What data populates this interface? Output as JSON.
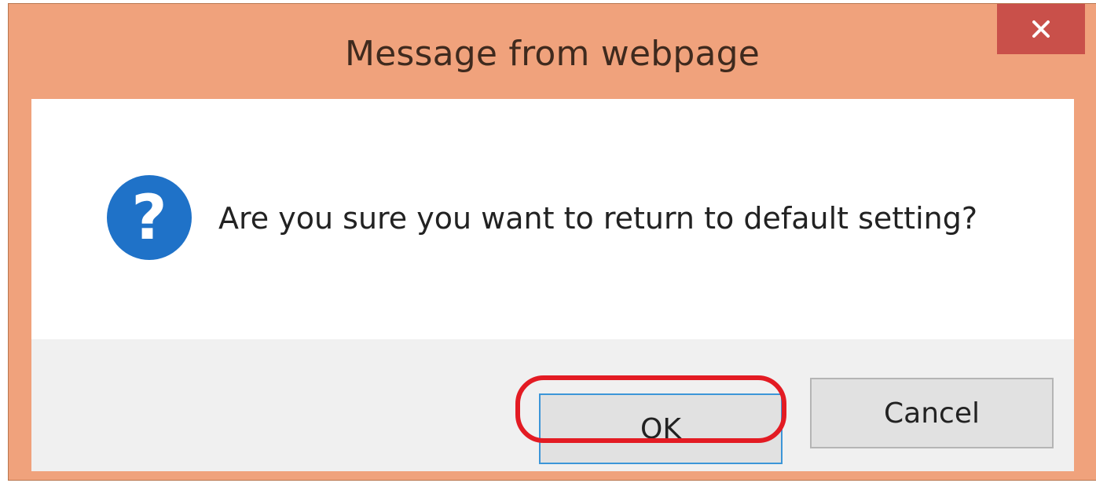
{
  "dialog": {
    "title": "Message from webpage",
    "close_glyph": "×",
    "title_bar_color": "#f0a27c",
    "close_button_color": "#c9504a"
  },
  "body": {
    "icon": "question-icon",
    "message": "Are you sure you want to return to default setting?"
  },
  "buttons": {
    "ok_label": "OK",
    "cancel_label": "Cancel"
  },
  "annotation": {
    "highlight": "ok-button",
    "color": "#e31b23"
  }
}
